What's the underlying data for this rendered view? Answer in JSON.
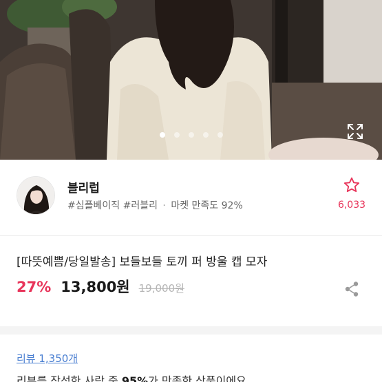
{
  "carousel": {
    "slide_count": 5,
    "active_index": 0
  },
  "seller": {
    "name": "블리럽",
    "tag1": "#심플베이직",
    "tag2": "#러블리",
    "separator": "·",
    "satisfaction": "마켓 만족도 92%",
    "favorite_count": "6,033"
  },
  "product": {
    "title": "[따뜻예쁨/당일발송] 보들보들 토끼 퍼 방울 캡 모자",
    "discount": "27%",
    "price": "13,800원",
    "original_price": "19,000원"
  },
  "reviews": {
    "link_label": "리뷰 1,350개",
    "summary_prefix": "리뷰를 작성한 사람 중 ",
    "summary_percent": "95%",
    "summary_suffix": "가 만족한 상품이에요"
  },
  "colors": {
    "accent": "#e8345a",
    "link": "#4a7fd1"
  },
  "icons": {
    "favorite": "star-outline-icon",
    "share": "share-icon",
    "expand": "fullscreen-icon"
  }
}
